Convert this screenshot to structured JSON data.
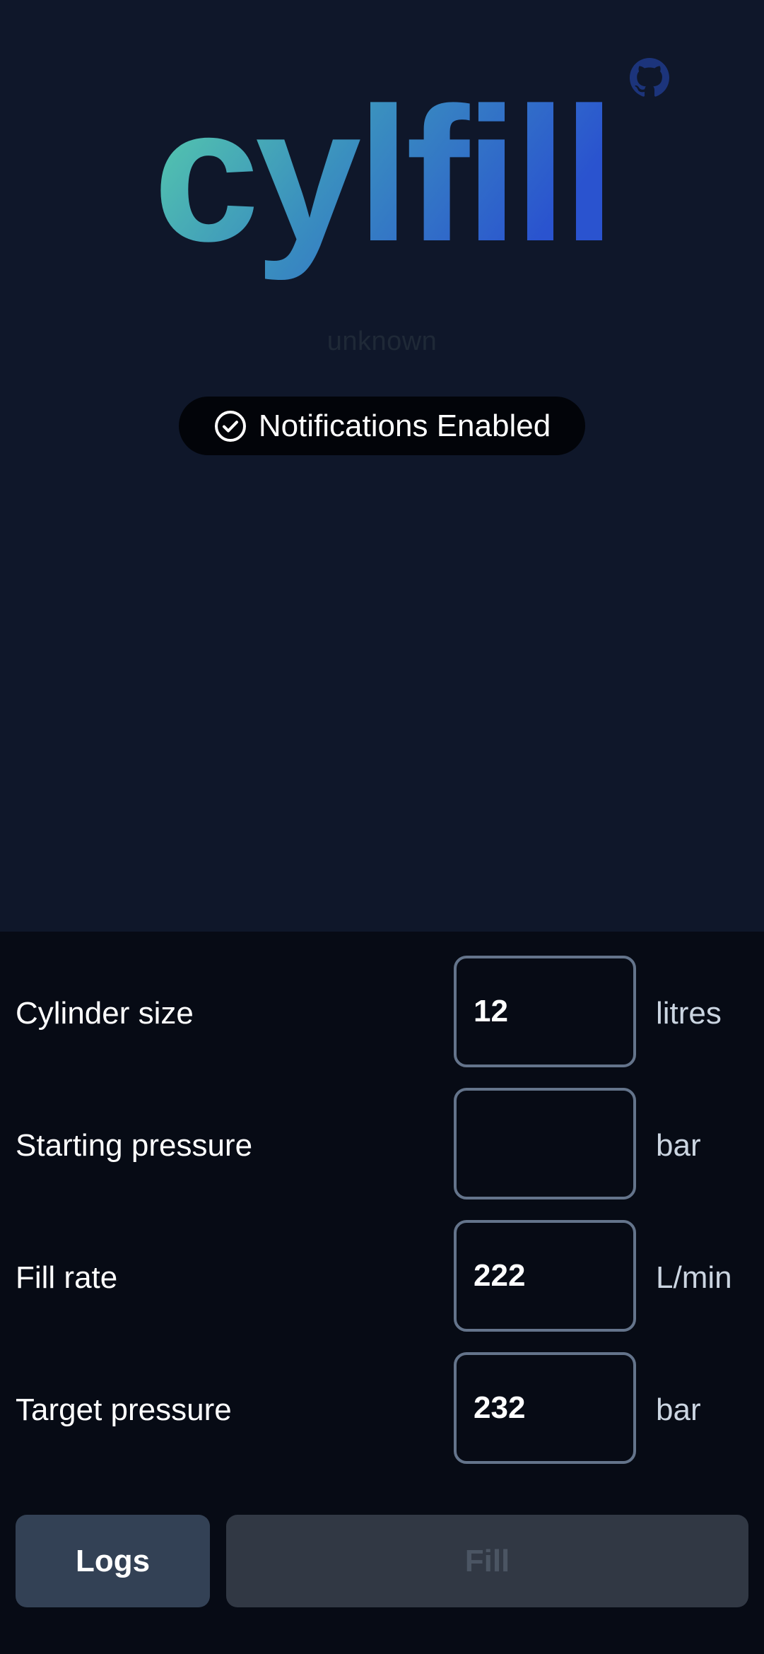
{
  "header": {
    "brand_text": "cylfill",
    "version_text": "unknown",
    "github_icon": "github-icon",
    "gradient_start": "#5ad3a9",
    "gradient_end": "#2a53cf"
  },
  "notification": {
    "label": "Notifications Enabled",
    "icon": "check-circle-icon"
  },
  "form": {
    "rows": [
      {
        "label": "Cylinder size",
        "value": "12",
        "unit": "litres"
      },
      {
        "label": "Starting pressure",
        "value": "",
        "unit": "bar"
      },
      {
        "label": "Fill rate",
        "value": "222",
        "unit": "L/min"
      },
      {
        "label": "Target pressure",
        "value": "232",
        "unit": "bar"
      }
    ]
  },
  "buttons": {
    "logs_label": "Logs",
    "fill_label": "Fill"
  },
  "colors": {
    "background": "#0f172a",
    "panel": "#070b15",
    "input_border": "#64748b",
    "logs_button": "#334155",
    "fill_button_disabled": "#313844"
  }
}
